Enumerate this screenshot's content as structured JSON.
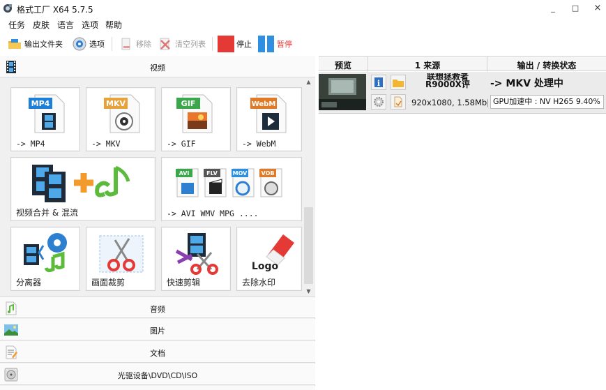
{
  "window": {
    "title": "格式工厂 X64 5.7.5",
    "minimize": "_",
    "maximize": "□",
    "close": "×"
  },
  "menu": [
    "任务",
    "皮肤",
    "语言",
    "选项",
    "帮助"
  ],
  "toolbar": {
    "output_folder": "输出文件夹",
    "options": "选项",
    "remove": "移除",
    "clear_list": "清空列表",
    "stop": "停止",
    "pause": "暂停"
  },
  "categories": {
    "video": "视频",
    "audio": "音频",
    "image": "图片",
    "document": "文档",
    "disc": "光驱设备\\DVD\\CD\\ISO"
  },
  "video_tiles": [
    {
      "label": "-> MP4",
      "badge": "MP4"
    },
    {
      "label": "-> MKV",
      "badge": "MKV"
    },
    {
      "label": "-> GIF",
      "badge": "GIF"
    },
    {
      "label": "-> WebM",
      "badge": "WebM"
    },
    {
      "label": "视频合并 & 混流"
    },
    {
      "label": "-> AVI WMV MPG ....",
      "badges": [
        "AVI",
        "FLV",
        "MOV",
        "VOB"
      ]
    },
    {
      "label": "分离器"
    },
    {
      "label": "画面裁剪"
    },
    {
      "label": "快速剪辑"
    },
    {
      "label": "去除水印",
      "logo_text": "Logo"
    }
  ],
  "task_table": {
    "headers": {
      "preview": "预览",
      "source": "1 来源",
      "output": "输出 / 转换状态"
    },
    "rows": [
      {
        "filename_line1": "联想拯救者",
        "filename_line2": "R9000X评",
        "info": "920x1080, 1.58Mb|",
        "output_status": "-> MKV 处理中",
        "gpu_status": "GPU加速中 : NV H265 9.40%",
        "progress": 9.4
      }
    ]
  },
  "colors": {
    "mp4": "#1e7fd8",
    "mkv": "#e8a23a",
    "gif": "#3aa84a",
    "webm": "#e07a26",
    "stop": "#e53935",
    "pause": "#2f8fe0"
  }
}
